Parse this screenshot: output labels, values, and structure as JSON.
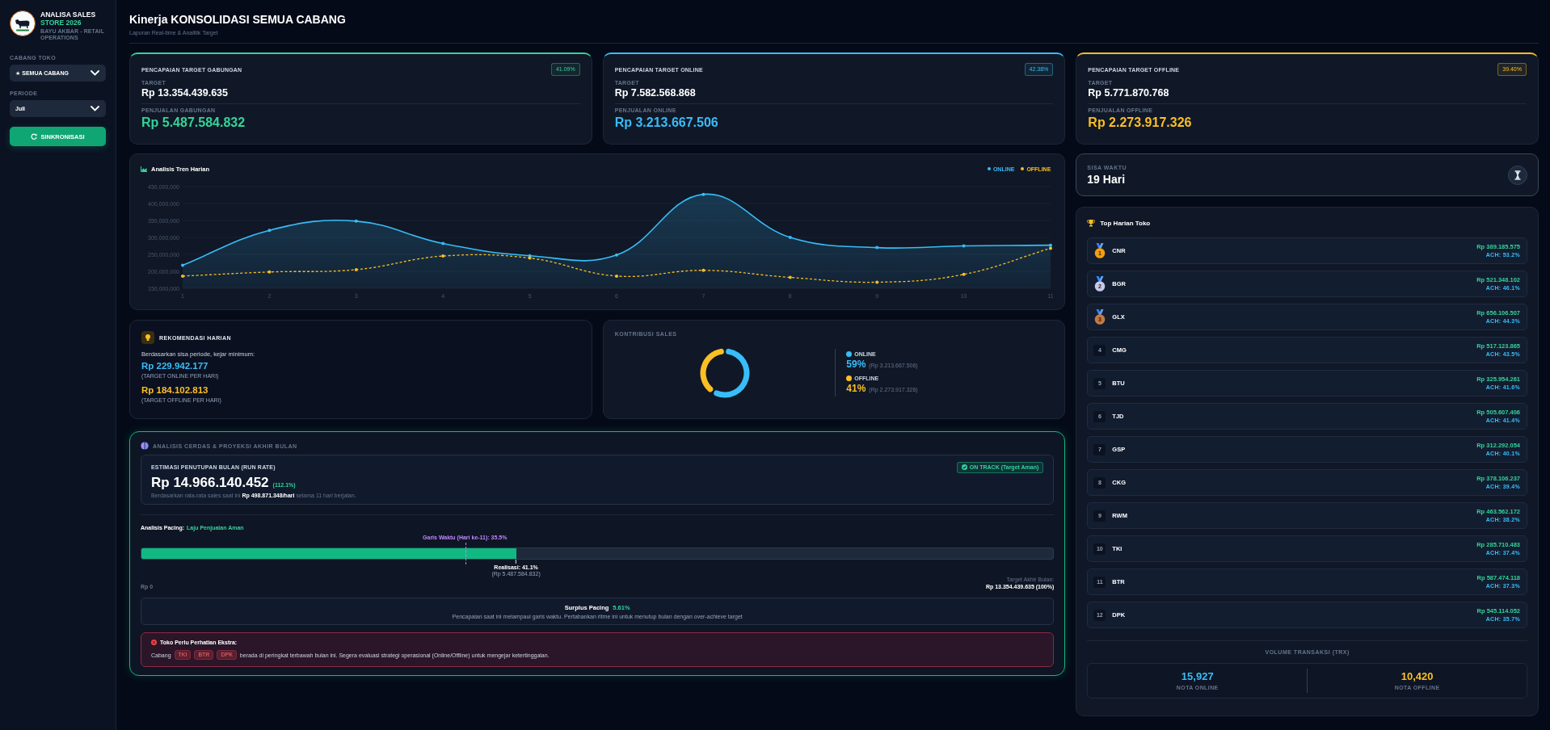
{
  "sidebar": {
    "brand": {
      "title": "ANALISA SALES",
      "subtitle": "STORE 2026",
      "caption": "BAYU AKBAR - RETAIL OPERATIONS"
    },
    "filters": [
      {
        "label": "CABANG TOKO",
        "value": "★ SEMUA CABANG"
      },
      {
        "label": "PERIODE",
        "value": "Juli"
      }
    ],
    "sync_button": "SINKRONISASI"
  },
  "header": {
    "title": "Kinerja KONSOLIDASI SEMUA CABANG",
    "subtitle": "Laporan Real-time & Analitik Target"
  },
  "target_cards": [
    {
      "title": "PENCAPAIAN TARGET GABUNGAN",
      "badge": "41.09%",
      "target_label": "TARGET",
      "target": "Rp 13.354.439.635",
      "sales_label": "PENJUALAN GABUNGAN",
      "sales": "Rp 5.487.584.832",
      "color": "#34d399"
    },
    {
      "title": "PENCAPAIAN TARGET ONLINE",
      "badge": "42.38%",
      "target_label": "TARGET",
      "target": "Rp 7.582.568.868",
      "sales_label": "PENJUALAN ONLINE",
      "sales": "Rp 3.213.667.506",
      "color": "#38bdf8"
    },
    {
      "title": "PENCAPAIAN TARGET OFFLINE",
      "badge": "39.40%",
      "target_label": "TARGET",
      "target": "Rp 5.771.870.768",
      "sales_label": "PENJUALAN OFFLINE",
      "sales": "Rp 2.273.917.326",
      "color": "#fbbf24"
    }
  ],
  "trend": {
    "chart_data": {
      "type": "line",
      "title": "Analisis Tren Harian",
      "categories": [
        "1",
        "2",
        "3",
        "4",
        "5",
        "6",
        "7",
        "8",
        "9",
        "10",
        "11"
      ],
      "series": [
        {
          "name": "ONLINE",
          "type": "area",
          "line_style": "solid",
          "color": "#38bdf8",
          "values": [
            218000000,
            321000000,
            348000000,
            282000000,
            246000000,
            248000000,
            427000000,
            300000000,
            270000000,
            275000000,
            277000000
          ]
        },
        {
          "name": "OFFLINE",
          "type": "line",
          "line_style": "dashed",
          "color": "#fbbf24",
          "values": [
            186000000,
            198000000,
            205000000,
            245000000,
            239000000,
            186000000,
            203000000,
            182000000,
            168000000,
            191000000,
            268000000
          ]
        }
      ],
      "ylim": [
        150000000,
        450000000
      ],
      "yticks": [
        {
          "value": 150000000,
          "label": "150,000,000"
        },
        {
          "value": 200000000,
          "label": "200,000,000"
        },
        {
          "value": 250000000,
          "label": "250,000,000"
        },
        {
          "value": 300000000,
          "label": "300,000,000"
        },
        {
          "value": 350000000,
          "label": "350,000,000"
        },
        {
          "value": 400000000,
          "label": "400,000,000"
        },
        {
          "value": 450000000,
          "label": "450,000,000"
        }
      ]
    }
  },
  "recommendation": {
    "title": "REKOMENDASI HARIAN",
    "intro": "Berdasarkan sisa periode, kejar minimum:",
    "targets": [
      {
        "amount": "Rp 229.942.177",
        "note": "(TARGET ONLINE PER HARI)",
        "color": "#38bdf8"
      },
      {
        "amount": "Rp 184.102.813",
        "note": "(TARGET OFFLINE PER HARI)",
        "color": "#fbbf24"
      }
    ]
  },
  "contribution": {
    "chart_data": {
      "type": "donut",
      "title": "KONTRIBUSI SALES",
      "categories": [
        "ONLINE",
        "OFFLINE"
      ],
      "values": [
        59,
        41
      ],
      "legend": "right"
    },
    "legend": [
      {
        "percent": "59%",
        "amount": "(Rp 3.213.667.506)",
        "color": "#38bdf8"
      },
      {
        "percent": "41%",
        "amount": "(Rp 2.273.917.326)",
        "color": "#fbbf24"
      }
    ]
  },
  "analysis": {
    "title": "ANALISIS CERDAS & PROYEKSI AKHIR BULAN",
    "run_rate": {
      "title": "ESTIMASI PENUTUPAN BULAN (RUN RATE)",
      "status": "ON TRACK (Target Aman)",
      "value": "Rp 14.966.140.452",
      "percent": "(112.1%)",
      "note": "Berdasarkan rata-rata sales saat ini **Rp 498.871.348/hari** selama 11 hari berjalan."
    },
    "pacing": {
      "label": "Analisis Pacing:",
      "status": "Laju Penjualan Aman",
      "progress": {
        "level": 0.411
      },
      "timeline": {
        "label": "Garis Waktu (Hari ke-11): 35.5%",
        "level": 0.355
      },
      "realization": {
        "label": "Realisasi: 41.1%",
        "amount": "(Rp 5.487.584.832)"
      },
      "start_label": "Rp 0",
      "end_label": "Target Akhir Bulan:",
      "end_value": "Rp 13.354.439.635 (100%)"
    },
    "surplus": {
      "label": "Surplus Pacing",
      "value": "5.61%",
      "note": "Pencapaian saat ini melampaui garis waktu. Pertahankan ritme ini untuk menutup bulan dengan over-achieve target"
    },
    "alert": {
      "title": "Toko Perlu Perhatian Ekstra:",
      "prefix": "Cabang",
      "stores": [
        "TKI",
        "BTR",
        "DPK"
      ],
      "message": "berada di peringkat terbawah bulan ini. Segera evaluasi strategi operasional (Online/Offline) untuk mengejar ketertinggalan."
    }
  },
  "remaining_time": {
    "label": "SISA WAKTU",
    "value": "19 Hari"
  },
  "top_stores": {
    "title": "Top Harian Toko",
    "rows": [
      {
        "kind": "medal",
        "rank": "1",
        "color": "#f59e0b",
        "name": "CNR",
        "sales": "Rp 389.185.575",
        "achievement": "ACH: 53.2%"
      },
      {
        "kind": "medal",
        "rank": "2",
        "color": "#c7c9ea",
        "name": "BGR",
        "sales": "Rp 521.348.102",
        "achievement": "ACH: 46.1%"
      },
      {
        "kind": "medal",
        "rank": "3",
        "color": "#c87941",
        "name": "GLX",
        "sales": "Rp 656.106.507",
        "achievement": "ACH: 44.3%"
      },
      {
        "kind": "rank",
        "rank": "4",
        "name": "CMG",
        "sales": "Rp 517.123.865",
        "achievement": "ACH: 43.5%"
      },
      {
        "kind": "rank",
        "rank": "5",
        "name": "BTU",
        "sales": "Rp 325.954.261",
        "achievement": "ACH: 41.6%"
      },
      {
        "kind": "rank",
        "rank": "6",
        "name": "TJD",
        "sales": "Rp 505.607.406",
        "achievement": "ACH: 41.4%"
      },
      {
        "kind": "rank",
        "rank": "7",
        "name": "GSP",
        "sales": "Rp 312.292.054",
        "achievement": "ACH: 40.1%"
      },
      {
        "kind": "rank",
        "rank": "8",
        "name": "CKG",
        "sales": "Rp 378.106.237",
        "achievement": "ACH: 39.4%"
      },
      {
        "kind": "rank",
        "rank": "9",
        "name": "RWM",
        "sales": "Rp 463.562.172",
        "achievement": "ACH: 38.2%"
      },
      {
        "kind": "rank",
        "rank": "10",
        "name": "TKI",
        "sales": "Rp 285.710.483",
        "achievement": "ACH: 37.4%"
      },
      {
        "kind": "rank",
        "rank": "11",
        "name": "BTR",
        "sales": "Rp 587.474.118",
        "achievement": "ACH: 37.3%"
      },
      {
        "kind": "rank",
        "rank": "12",
        "name": "DPK",
        "sales": "Rp 545.114.052",
        "achievement": "ACH: 35.7%"
      }
    ],
    "volume": {
      "title": "VOLUME TRANSAKSI (TRX)",
      "items": [
        {
          "value": "15,927",
          "label": "NOTA ONLINE",
          "color": "#38bdf8"
        },
        {
          "value": "10,420",
          "label": "NOTA OFFLINE",
          "color": "#fbbf24"
        }
      ]
    }
  }
}
